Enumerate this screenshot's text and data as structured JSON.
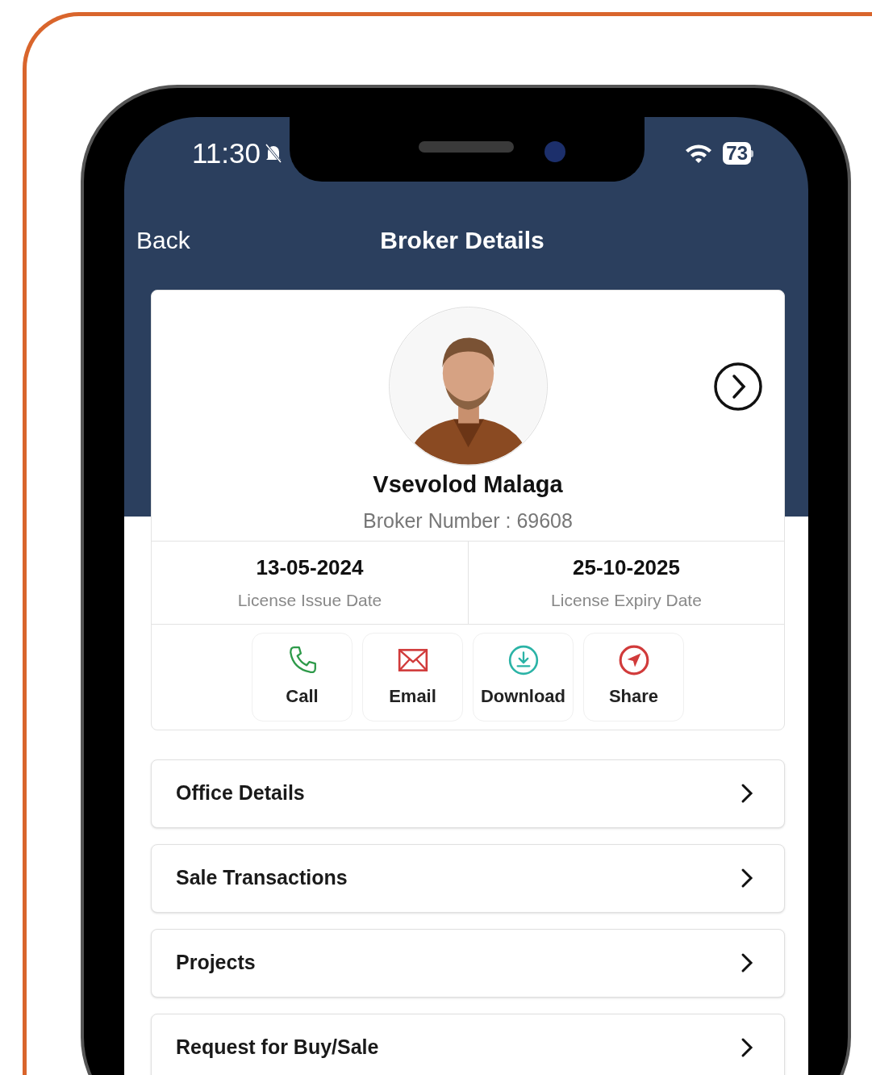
{
  "status_bar": {
    "time": "11:30",
    "battery": "73"
  },
  "nav": {
    "back": "Back",
    "title": "Broker Details"
  },
  "profile": {
    "name": "Vsevolod Malaga",
    "broker_number": "Broker Number : 69608"
  },
  "dates": [
    {
      "value": "13-05-2024",
      "label": "License Issue Date"
    },
    {
      "value": "25-10-2025",
      "label": "License Expiry Date"
    }
  ],
  "actions": [
    {
      "label": "Call",
      "kind": "call"
    },
    {
      "label": "Email",
      "kind": "email"
    },
    {
      "label": "Download",
      "kind": "download"
    },
    {
      "label": "Share",
      "kind": "share"
    }
  ],
  "menu": [
    {
      "label": "Office Details"
    },
    {
      "label": "Sale Transactions"
    },
    {
      "label": "Projects"
    },
    {
      "label": "Request for Buy/Sale"
    }
  ]
}
